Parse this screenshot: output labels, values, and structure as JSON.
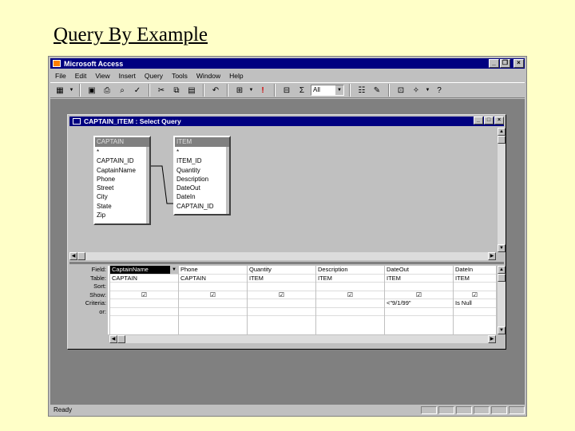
{
  "slide": {
    "title": "Query By Example"
  },
  "app": {
    "title": "Microsoft Access",
    "menu": [
      "File",
      "Edit",
      "View",
      "Insert",
      "Query",
      "Tools",
      "Window",
      "Help"
    ],
    "toolbar": {
      "top_values_value": "All"
    },
    "status": "Ready"
  },
  "query_window": {
    "title": "CAPTAIN_ITEM : Select Query",
    "tables": [
      {
        "name": "CAPTAIN",
        "fields": [
          "*",
          "CAPTAIN_ID",
          "CaptainName",
          "Phone",
          "Street",
          "City",
          "State",
          "Zip"
        ]
      },
      {
        "name": "ITEM",
        "fields": [
          "*",
          "ITEM_ID",
          "Quantity",
          "Description",
          "DateOut",
          "DateIn",
          "CAPTAIN_ID"
        ]
      }
    ],
    "grid": {
      "row_labels": [
        "Field:",
        "Table:",
        "Sort:",
        "Show:",
        "Criteria:",
        "or:"
      ],
      "columns": [
        {
          "field": "CaptainName",
          "table": "CAPTAIN",
          "show": "☑",
          "criteria": ""
        },
        {
          "field": "Phone",
          "table": "CAPTAIN",
          "show": "☑",
          "criteria": ""
        },
        {
          "field": "Quantity",
          "table": "ITEM",
          "show": "☑",
          "criteria": ""
        },
        {
          "field": "Description",
          "table": "ITEM",
          "show": "☑",
          "criteria": ""
        },
        {
          "field": "DateOut",
          "table": "ITEM",
          "show": "☑",
          "criteria": "<\"9/1/99\""
        },
        {
          "field": "DateIn",
          "table": "ITEM",
          "show": "☑",
          "criteria": "Is Null"
        }
      ]
    }
  }
}
